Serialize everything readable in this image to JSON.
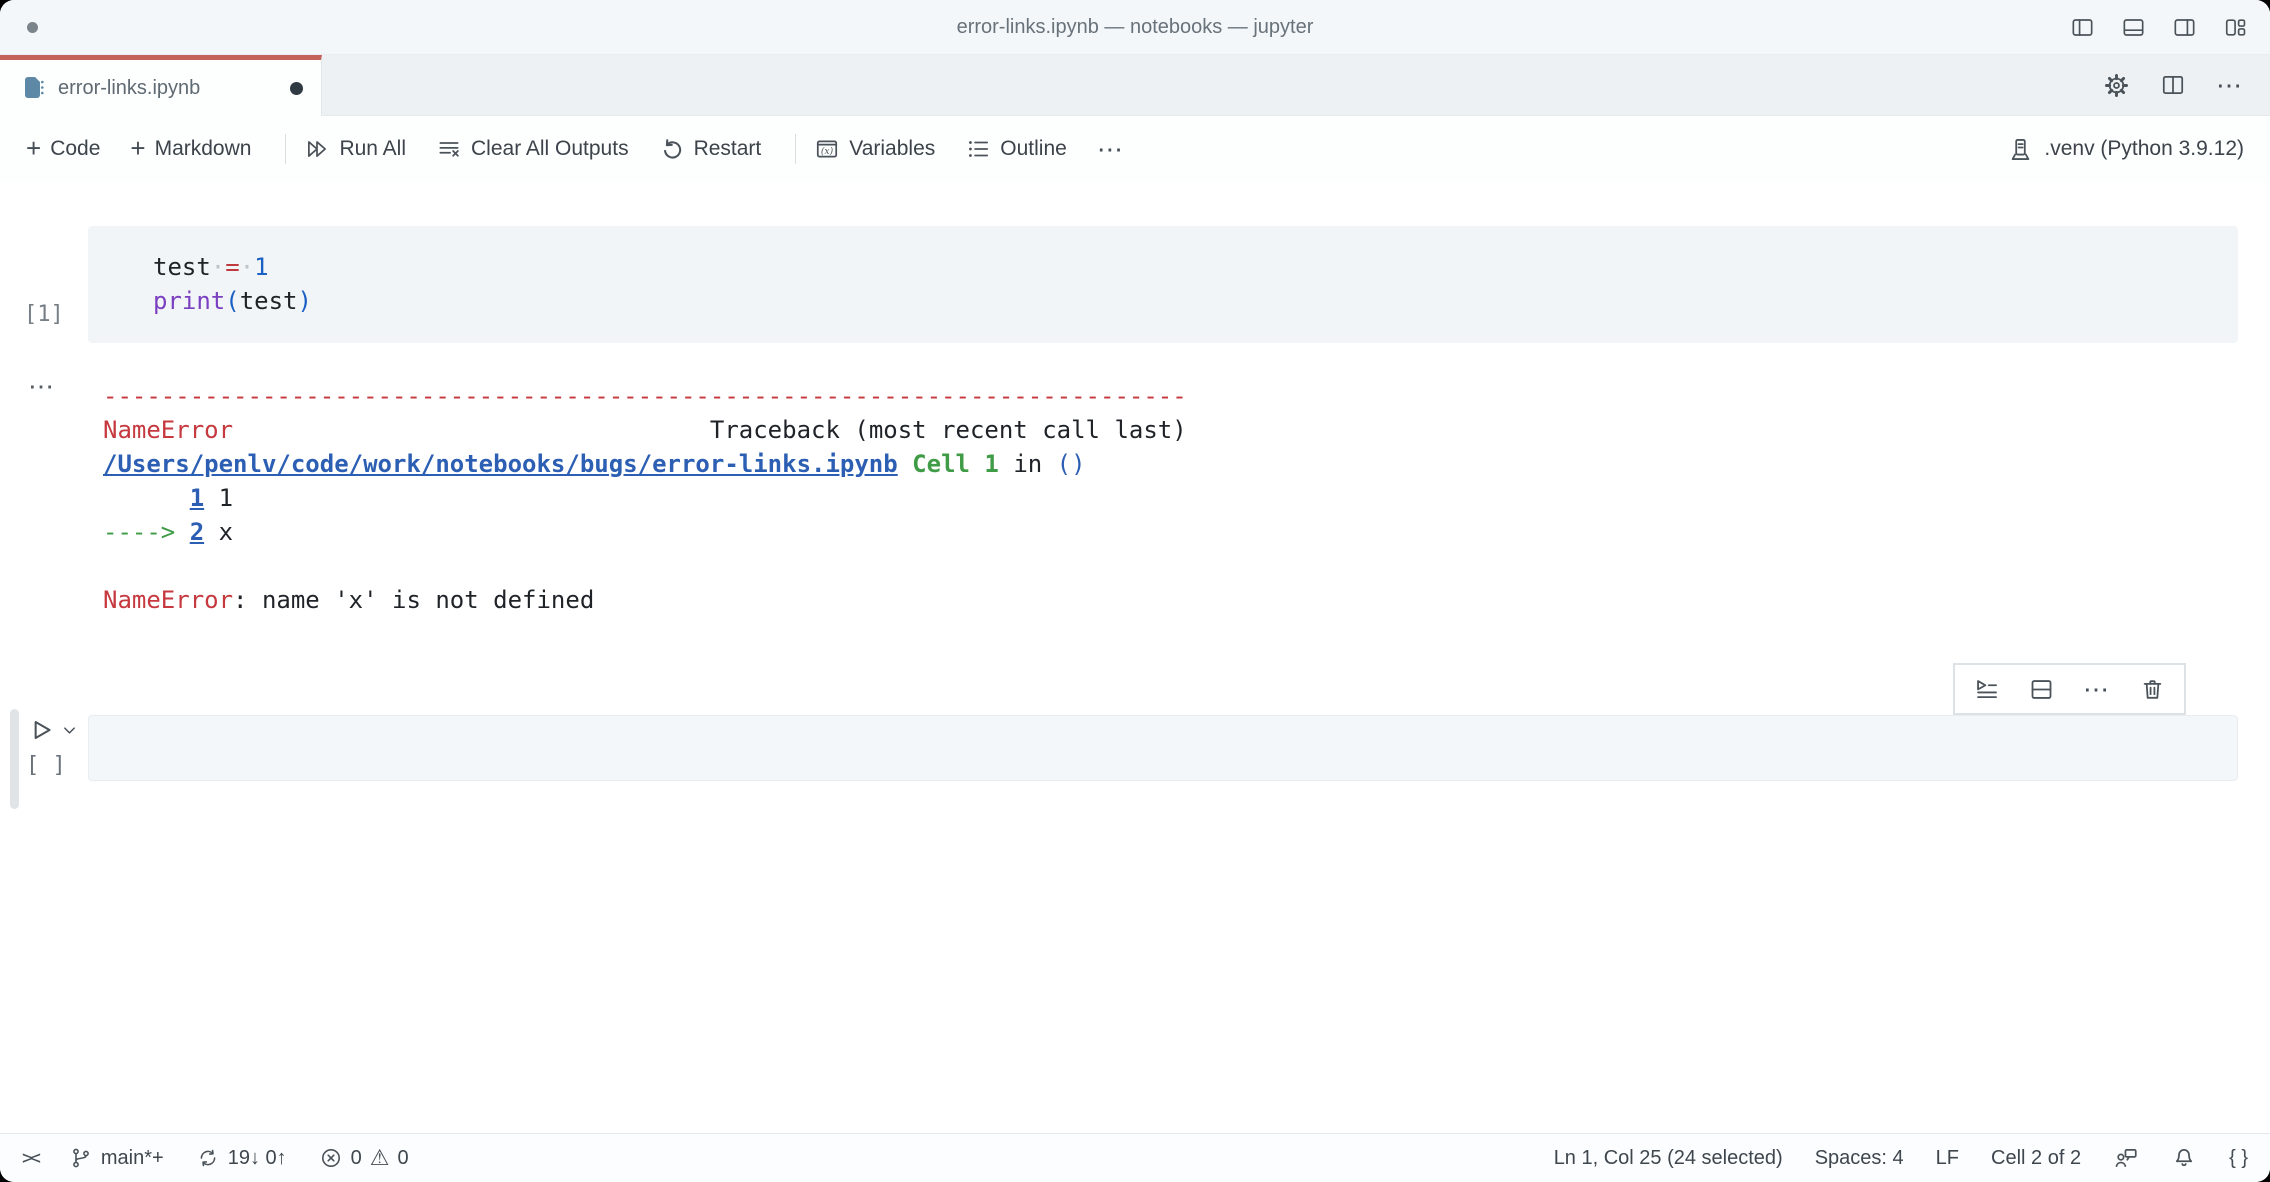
{
  "window": {
    "title": "error-links.ipynb — notebooks — jupyter"
  },
  "tab": {
    "label": "error-links.ipynb"
  },
  "tabbar_actions": {
    "more": "⋯"
  },
  "toolbar": {
    "code": "Code",
    "markdown": "Markdown",
    "run_all": "Run All",
    "clear_all_outputs": "Clear All Outputs",
    "restart": "Restart",
    "variables": "Variables",
    "outline": "Outline",
    "more": "⋯",
    "kernel": ".venv (Python 3.9.12)"
  },
  "cell1": {
    "execution_count": "[1]",
    "code_lines": [
      [
        {
          "t": "test",
          "c": "plain"
        },
        {
          "t": "·",
          "c": "ws"
        },
        {
          "t": "=",
          "c": "op"
        },
        {
          "t": "·",
          "c": "ws"
        },
        {
          "t": "1",
          "c": "num"
        }
      ],
      [
        {
          "t": "print",
          "c": "fn"
        },
        {
          "t": "(",
          "c": "paren"
        },
        {
          "t": "test",
          "c": "plain"
        },
        {
          "t": ")",
          "c": "paren"
        }
      ]
    ],
    "output_gutter": "⋯",
    "output_lines": [
      [
        {
          "t": "---------------------------------------------------------------------------",
          "c": "red"
        }
      ],
      [
        {
          "t": "NameError",
          "c": "red"
        },
        {
          "t": "                                 Traceback (most recent call last)",
          "c": "plain"
        }
      ],
      [
        {
          "t": "/Users/penlv/code/work/notebooks/bugs/error-links.ipynb",
          "c": "link"
        },
        {
          "t": " ",
          "c": "plain"
        },
        {
          "t": "Cell 1",
          "c": "greenb"
        },
        {
          "t": " in ",
          "c": "plain"
        },
        {
          "t": "()",
          "c": "blue"
        }
      ],
      [
        {
          "t": "      ",
          "c": "plain"
        },
        {
          "t": "1",
          "c": "link"
        },
        {
          "t": " 1",
          "c": "plain"
        }
      ],
      [
        {
          "t": "----> ",
          "c": "green"
        },
        {
          "t": "2",
          "c": "link"
        },
        {
          "t": " x",
          "c": "plain"
        }
      ],
      [],
      [
        {
          "t": "NameError",
          "c": "red"
        },
        {
          "t": ": name 'x' is not defined",
          "c": "plain"
        }
      ]
    ]
  },
  "cell2": {
    "execution_count": "[ ]"
  },
  "status_bar": {
    "remote": "><",
    "branch": "main*+",
    "sync": "19↓ 0↑",
    "errors": "0",
    "warnings": "0",
    "warning_glyph": "⚠",
    "cursor": "Ln 1, Col 25 (24 selected)",
    "indent": "Spaces: 4",
    "eol": "LF",
    "cell_position": "Cell 2 of 2",
    "braces": "{ }"
  },
  "colors": {
    "tab_accent": "#c4635a",
    "error_red": "#c5393f",
    "link_blue": "#2c5fb3",
    "traceback_green": "#3f9b45",
    "notebook_icon": "#5d89a6"
  }
}
